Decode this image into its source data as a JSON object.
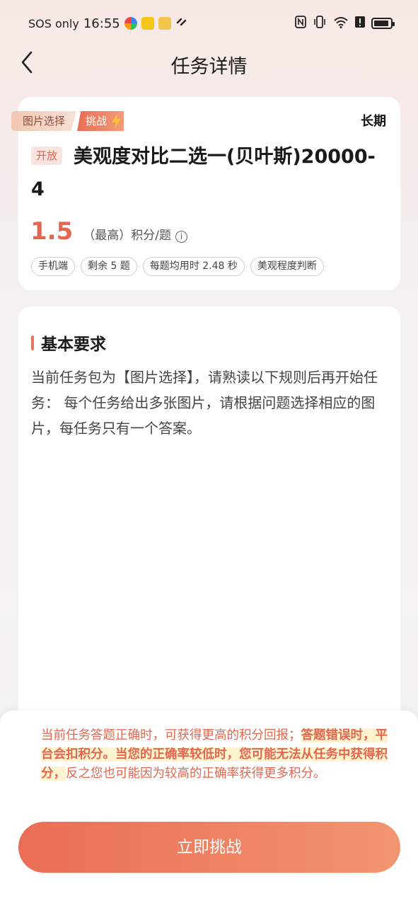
{
  "status_bar": {
    "carrier": "SOS only",
    "time": "16:55"
  },
  "nav": {
    "title": "任务详情"
  },
  "task": {
    "type_tag": "图片选择",
    "challenge_tag": "挑战",
    "period": "长期",
    "status": "开放",
    "title": "美观度对比二选一(贝叶斯)20000-4",
    "score": "1.5",
    "score_unit": "（最高）积分/题",
    "chips": [
      "手机端",
      "剩余 5 题",
      "每题均用时 2.48 秒",
      "美观程度判断"
    ]
  },
  "requirements": {
    "heading": "基本要求",
    "text": "当前任务包为【图片选择】，请熟读以下规则后再开始任务： 每个任务给出多张图片，请根据问题选择相应的图片，每任务只有一个答案。"
  },
  "notice": {
    "part1": "当前任务答题正确时，可获得更高的积分回报；",
    "highlight": "答题错误时，平台会扣积分。当您的正确率较低时，您可能无法从任务中获得积分，",
    "part2": "反之您也可能因为较高的正确率获得更多积分。"
  },
  "action": {
    "start_label": "立即挑战"
  },
  "colors": {
    "accent": "#e2674e",
    "button_start": "#ea6e55",
    "button_end": "#f2956f"
  }
}
